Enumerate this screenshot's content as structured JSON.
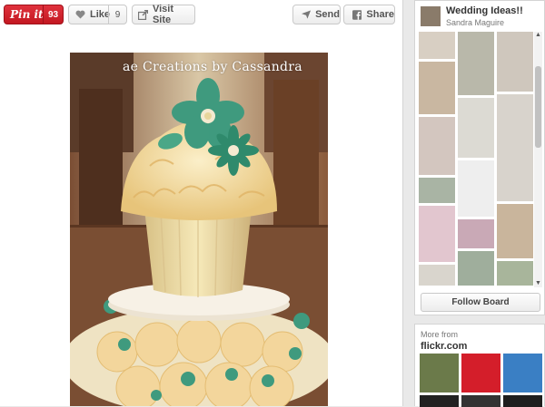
{
  "toolbar": {
    "pinit_label": "Pin it",
    "pinit_count": "93",
    "like_label": "Like",
    "like_count": "9",
    "visit_label": "Visit Site",
    "send_label": "Send",
    "share_label": "Share"
  },
  "photo": {
    "caption": "ae Creations by Cassandra"
  },
  "board": {
    "title": "Wedding Ideas!!",
    "owner": "Sandra Maguire",
    "follow_label": "Follow Board"
  },
  "more_from": {
    "label": "More from",
    "source": "flickr.com"
  },
  "colors": {
    "pinit_red": "#c31821",
    "frosting": "#f2d7a0",
    "flower_teal": "#3f9a7e"
  },
  "icons": {
    "like": "heart-icon",
    "visit": "external-link-icon",
    "send": "paper-plane-icon",
    "share": "facebook-icon"
  }
}
